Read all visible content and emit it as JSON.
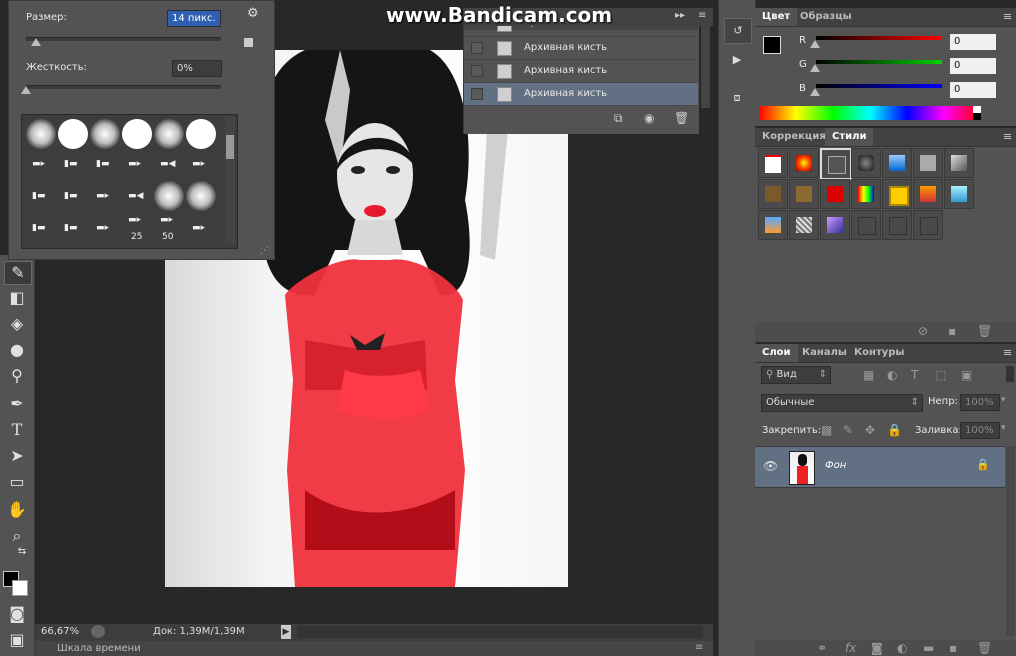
{
  "watermark": "www.Bandicam.com",
  "brush_popup": {
    "size_label": "Размер:",
    "size_value": "14 пикс.",
    "hardness_label": "Жесткость:",
    "hardness_value": "0%",
    "hardness_level": 0.0,
    "size_level": 0.05,
    "preset_numbers": [
      "25",
      "50"
    ]
  },
  "history": {
    "items": [
      {
        "label": "Архивная кисть"
      },
      {
        "label": "Архивная кисть"
      },
      {
        "label": "Архивная кисть"
      }
    ]
  },
  "color_panel": {
    "tabs": [
      "Цвет",
      "Образцы"
    ],
    "channels": [
      {
        "name": "R",
        "value": "0",
        "color": "#ff0000"
      },
      {
        "name": "G",
        "value": "0",
        "color": "#00cc00"
      },
      {
        "name": "B",
        "value": "0",
        "color": "#0000ff"
      }
    ]
  },
  "styles_panel": {
    "tabs": [
      "Коррекция",
      "Стили"
    ]
  },
  "layers_panel": {
    "tabs": [
      "Слои",
      "Каналы",
      "Контуры"
    ],
    "filter_label": "Вид",
    "blend_mode": "Обычные",
    "opacity_label": "Непр:",
    "opacity_value": "100%",
    "lock_label": "Закрепить:",
    "fill_label": "Заливка:",
    "fill_value": "100%",
    "layer_name": "Фон"
  },
  "status_bar": {
    "zoom": "66,67%",
    "doc_info": "Док: 1,39M/1,39M"
  },
  "timeline_label": "Шкала времени",
  "accent_color": "#617083"
}
